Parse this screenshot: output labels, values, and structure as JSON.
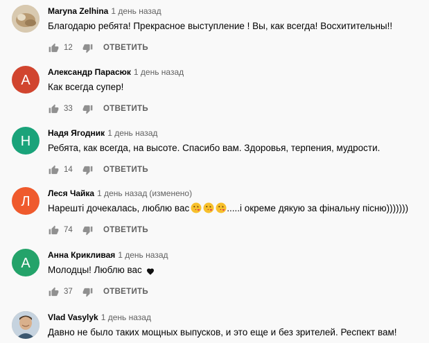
{
  "comments": [
    {
      "author": "Maryna Zelhina",
      "time": "1 день назад",
      "edited": "",
      "text": "Благодарю ребята! Прекрасное выступление ! Вы, как всегда!  Восхитительны!!",
      "likes": "12",
      "reply": "ОТВЕТИТЬ",
      "avatar": {
        "type": "photo",
        "color": "#c9b79c"
      }
    },
    {
      "author": "Александр Парасюк",
      "time": "1 день назад",
      "edited": "",
      "text": "Как всегда супер!",
      "likes": "33",
      "reply": "ОТВЕТИТЬ",
      "avatar": {
        "type": "letter",
        "letter": "А",
        "color": "#d1452f"
      }
    },
    {
      "author": "Надя Ягодник",
      "time": "1 день назад",
      "edited": "",
      "text": "Ребята, как всегда, на высоте. Спасибо вам. Здоровья, терпения, мудрости.",
      "likes": "14",
      "reply": "ОТВЕТИТЬ",
      "avatar": {
        "type": "letter",
        "letter": "Н",
        "color": "#1aa37a"
      }
    },
    {
      "author": "Леся Чайка",
      "time": "1 день назад",
      "edited": "(изменено)",
      "text_parts": [
        "Нарешті дочекалась, люблю вас",
        ".....і окреме дякую за фінальну пісню)))))))"
      ],
      "emojis": [
        "kissing-face-emoji",
        "kissing-face-emoji",
        "kissing-face-emoji"
      ],
      "likes": "74",
      "reply": "ОТВЕТИТЬ",
      "avatar": {
        "type": "letter",
        "letter": "Л",
        "color": "#ef5a2d"
      }
    },
    {
      "author": "Анна Крикливая",
      "time": "1 день назад",
      "edited": "",
      "text": "Молодцы! Люблю вас",
      "suffix_icon": "black-heart-icon",
      "likes": "37",
      "reply": "ОТВЕТИТЬ",
      "avatar": {
        "type": "letter",
        "letter": "А",
        "color": "#24a36a"
      }
    },
    {
      "author": "Vlad Vasylyk",
      "time": "1 день назад",
      "edited": "",
      "text": "Давно не было таких мощных выпусков, и это еще и без зрителей. Респект вам!",
      "likes": "",
      "reply": "",
      "avatar": {
        "type": "photo",
        "color": "#b7a48c"
      }
    }
  ]
}
